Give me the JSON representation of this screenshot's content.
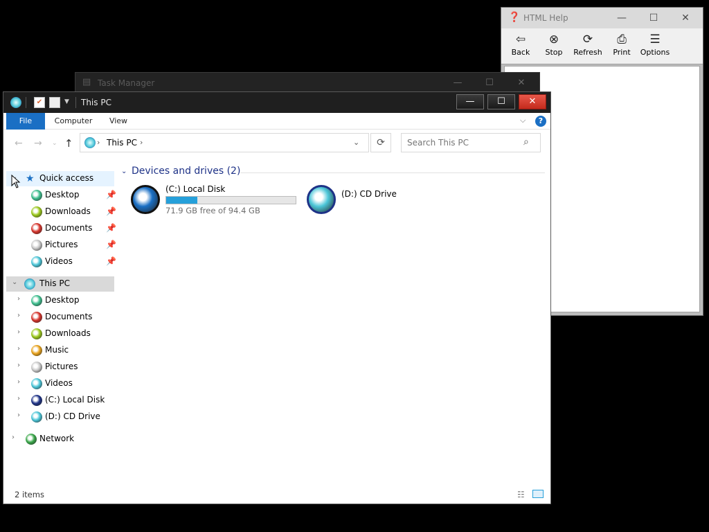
{
  "help_window": {
    "title": "HTML Help",
    "toolbar": [
      {
        "icon": "back-arrow-icon",
        "glyph": "⇦",
        "label": "Back"
      },
      {
        "icon": "stop-icon",
        "glyph": "⊗",
        "label": "Stop"
      },
      {
        "icon": "refresh-icon",
        "glyph": "⟳",
        "label": "Refresh"
      },
      {
        "icon": "print-icon",
        "glyph": "⎙",
        "label": "Print"
      },
      {
        "icon": "options-icon",
        "glyph": "☰",
        "label": "Options"
      }
    ]
  },
  "task_manager": {
    "title": "Task Manager"
  },
  "explorer": {
    "title": "This PC",
    "ribbon": {
      "file": "File",
      "computer": "Computer",
      "view": "View",
      "help": "?"
    },
    "address": {
      "path": "This PC"
    },
    "search": {
      "placeholder": "Search This PC"
    },
    "nav": {
      "quick_access": {
        "label": "Quick access",
        "items": [
          {
            "label": "Desktop",
            "color": "#3fbf8f",
            "pinned": true
          },
          {
            "label": "Downloads",
            "color": "#9bc81c",
            "pinned": true
          },
          {
            "label": "Documents",
            "color": "#d6342c",
            "pinned": true
          },
          {
            "label": "Pictures",
            "color": "#c9c9c9",
            "pinned": true
          },
          {
            "label": "Videos",
            "color": "#4cc6d8",
            "pinned": true
          }
        ]
      },
      "this_pc": {
        "label": "This PC",
        "items": [
          {
            "label": "Desktop",
            "color": "#3fbf8f"
          },
          {
            "label": "Documents",
            "color": "#d6342c"
          },
          {
            "label": "Downloads",
            "color": "#9bc81c"
          },
          {
            "label": "Music",
            "color": "#e8a21c"
          },
          {
            "label": "Pictures",
            "color": "#c9c9c9"
          },
          {
            "label": "Videos",
            "color": "#4cc6d8"
          },
          {
            "label": "(C:) Local Disk",
            "color": "#1e3287"
          },
          {
            "label": "(D:) CD Drive",
            "color": "#4cc6d8"
          }
        ]
      },
      "network": {
        "label": "Network",
        "color": "#3aa84a"
      }
    },
    "content": {
      "group_header": "Devices and drives (2)",
      "drives": [
        {
          "name": "(C:) Local Disk",
          "free_text": "71.9 GB free of 94.4 GB",
          "used_fraction": 0.238,
          "color": "#1a6fc4"
        },
        {
          "name": "(D:) CD Drive",
          "color": "#4cc6d8"
        }
      ]
    },
    "status": "2 items"
  }
}
